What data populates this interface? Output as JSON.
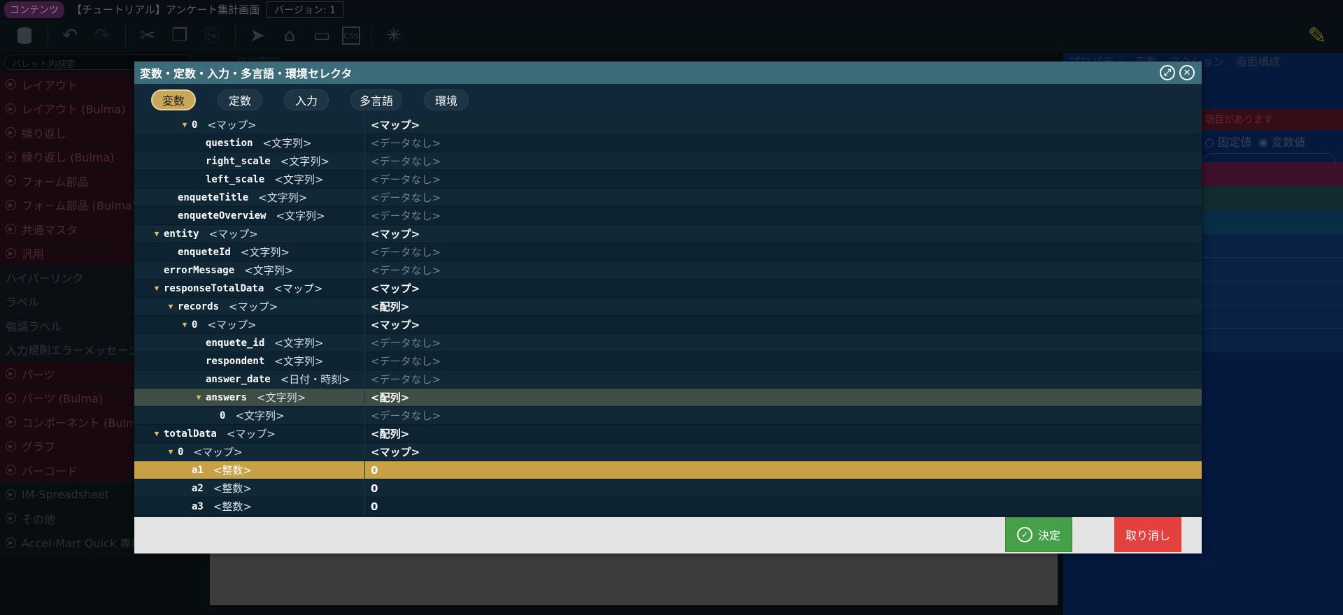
{
  "app": {
    "category_badge": "コンテンツ",
    "screen_title": "【チュートリアル】アンケート集計画面",
    "version": "バージョン: 1"
  },
  "palette": {
    "search_placeholder": "パレット内検索",
    "items": [
      {
        "label": "レイアウト",
        "kind": "cat"
      },
      {
        "label": "レイアウト (Bulma)",
        "kind": "cat"
      },
      {
        "label": "繰り返し",
        "kind": "cat"
      },
      {
        "label": "繰り返し (Bulma)",
        "kind": "cat"
      },
      {
        "label": "フォーム部品",
        "kind": "cat"
      },
      {
        "label": "フォーム部品 (Bulma)",
        "kind": "cat"
      },
      {
        "label": "共通マスタ",
        "kind": "cat"
      },
      {
        "label": "汎用",
        "kind": "cat"
      },
      {
        "label": "ハイパーリンク",
        "kind": "plain"
      },
      {
        "label": "ラベル",
        "kind": "plain"
      },
      {
        "label": "強調ラベル",
        "kind": "plain"
      },
      {
        "label": "入力規則エラーメッセージ",
        "kind": "plain"
      },
      {
        "label": "パーツ",
        "kind": "cat"
      },
      {
        "label": "パーツ (Bulma)",
        "kind": "cat"
      },
      {
        "label": "コンポーネント (Bulma)",
        "kind": "cat"
      },
      {
        "label": "グラフ",
        "kind": "cat"
      },
      {
        "label": "バーコード",
        "kind": "cat"
      },
      {
        "label": "IM-Spreadsheet",
        "kind": "dark"
      },
      {
        "label": "その他",
        "kind": "dark"
      },
      {
        "label": "Accel-Mart Quick 専用",
        "kind": "dark"
      }
    ]
  },
  "canvas": {
    "tab_label": "question"
  },
  "right_panel": {
    "tabs": [
      "プロパティ",
      "変数",
      "アクション",
      "画面構成"
    ],
    "warning": "項目があります",
    "radio_fixed": "固定値",
    "radio_variable": "変数値"
  },
  "dialog": {
    "title": "変数・定数・入力・多言語・環境セレクタ",
    "tabs": [
      {
        "label": "変数",
        "active": true
      },
      {
        "label": "定数",
        "active": false
      },
      {
        "label": "入力",
        "active": false
      },
      {
        "label": "多言語",
        "active": false
      },
      {
        "label": "環境",
        "active": false
      }
    ],
    "rows": [
      {
        "indent": 3,
        "expand": true,
        "name": "0",
        "type": "<マップ>",
        "value": "<マップ>",
        "nodata": false,
        "state": ""
      },
      {
        "indent": 4,
        "expand": false,
        "name": "question",
        "type": "<文字列>",
        "value": "<データなし>",
        "nodata": true,
        "state": ""
      },
      {
        "indent": 4,
        "expand": false,
        "name": "right_scale",
        "type": "<文字列>",
        "value": "<データなし>",
        "nodata": true,
        "state": ""
      },
      {
        "indent": 4,
        "expand": false,
        "name": "left_scale",
        "type": "<文字列>",
        "value": "<データなし>",
        "nodata": true,
        "state": ""
      },
      {
        "indent": 2,
        "expand": false,
        "name": "enqueteTitle",
        "type": "<文字列>",
        "value": "<データなし>",
        "nodata": true,
        "state": ""
      },
      {
        "indent": 2,
        "expand": false,
        "name": "enqueteOverview",
        "type": "<文字列>",
        "value": "<データなし>",
        "nodata": true,
        "state": ""
      },
      {
        "indent": 1,
        "expand": true,
        "name": "entity",
        "type": "<マップ>",
        "value": "<マップ>",
        "nodata": false,
        "state": ""
      },
      {
        "indent": 2,
        "expand": false,
        "name": "enqueteId",
        "type": "<文字列>",
        "value": "<データなし>",
        "nodata": true,
        "state": ""
      },
      {
        "indent": 1,
        "expand": false,
        "name": "errorMessage",
        "type": "<文字列>",
        "value": "<データなし>",
        "nodata": true,
        "state": ""
      },
      {
        "indent": 1,
        "expand": true,
        "name": "responseTotalData",
        "type": "<マップ>",
        "value": "<マップ>",
        "nodata": false,
        "state": ""
      },
      {
        "indent": 2,
        "expand": true,
        "name": "records",
        "type": "<マップ>",
        "value": "<配列>",
        "nodata": false,
        "state": ""
      },
      {
        "indent": 3,
        "expand": true,
        "name": "0",
        "type": "<マップ>",
        "value": "<マップ>",
        "nodata": false,
        "state": ""
      },
      {
        "indent": 4,
        "expand": false,
        "name": "enquete_id",
        "type": "<文字列>",
        "value": "<データなし>",
        "nodata": true,
        "state": ""
      },
      {
        "indent": 4,
        "expand": false,
        "name": "respondent",
        "type": "<文字列>",
        "value": "<データなし>",
        "nodata": true,
        "state": ""
      },
      {
        "indent": 4,
        "expand": false,
        "name": "answer_date",
        "type": "<日付・時刻>",
        "value": "<データなし>",
        "nodata": true,
        "state": ""
      },
      {
        "indent": 4,
        "expand": true,
        "name": "answers",
        "type": "<文字列>",
        "value": "<配列>",
        "nodata": false,
        "state": "sel-dim"
      },
      {
        "indent": 5,
        "expand": false,
        "name": "0",
        "type": "<文字列>",
        "value": "<データなし>",
        "nodata": true,
        "state": ""
      },
      {
        "indent": 1,
        "expand": true,
        "name": "totalData",
        "type": "<マップ>",
        "value": "<配列>",
        "nodata": false,
        "state": ""
      },
      {
        "indent": 2,
        "expand": true,
        "name": "0",
        "type": "<マップ>",
        "value": "<マップ>",
        "nodata": false,
        "state": ""
      },
      {
        "indent": 3,
        "expand": false,
        "name": "a1",
        "type": "<整数>",
        "value": "0",
        "nodata": false,
        "state": "sel"
      },
      {
        "indent": 3,
        "expand": false,
        "name": "a2",
        "type": "<整数>",
        "value": "0",
        "nodata": false,
        "state": ""
      },
      {
        "indent": 3,
        "expand": false,
        "name": "a3",
        "type": "<整数>",
        "value": "0",
        "nodata": false,
        "state": ""
      }
    ],
    "ok_label": "決定",
    "cancel_label": "取り消し"
  },
  "colors": {
    "dialog_header": "#3c6c7a",
    "selected_row": "#c8a045",
    "ok_button": "#46a049",
    "cancel_button": "#e34040",
    "active_tab": "#c9a85a"
  }
}
